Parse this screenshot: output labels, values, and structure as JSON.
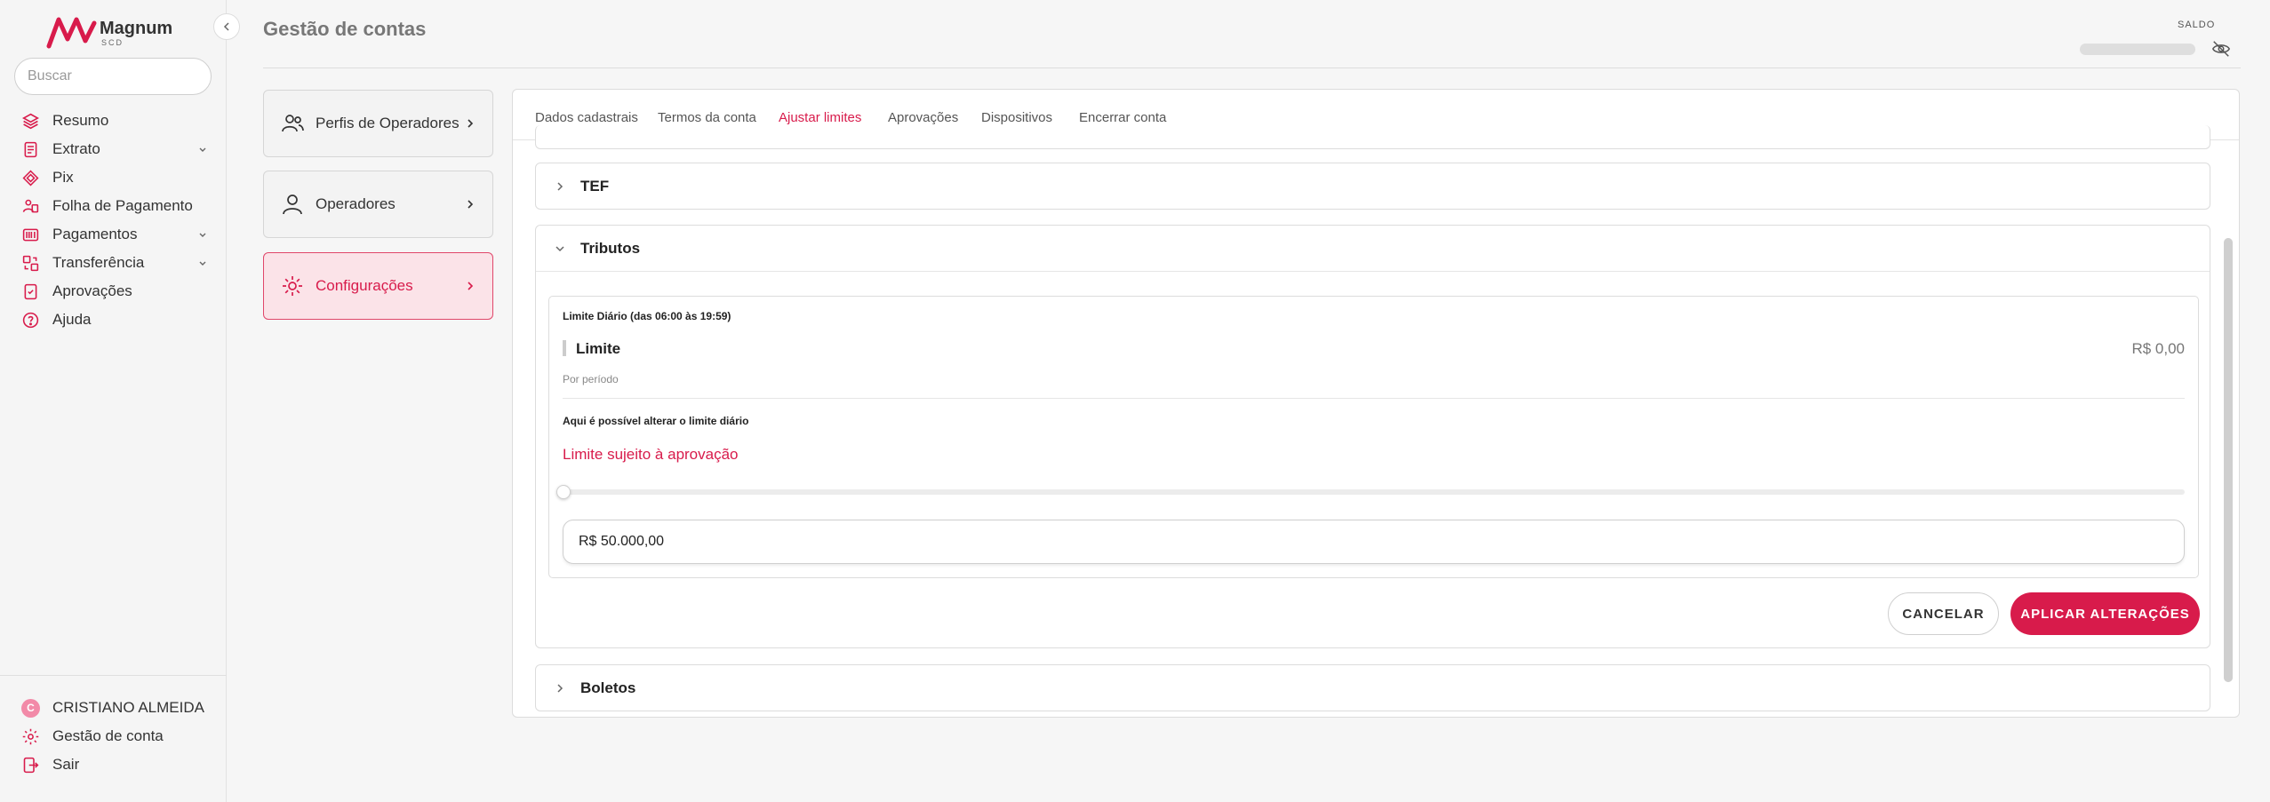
{
  "app": {
    "brand": "Magnum",
    "brand_sub": "SCD",
    "page_title": "Gestão de contas",
    "saldo_label": "SALDO",
    "accent_color": "#d81b4b"
  },
  "sidebar": {
    "search_placeholder": "Buscar",
    "items": [
      {
        "label": "Resumo",
        "icon": "layers-icon"
      },
      {
        "label": "Extrato",
        "icon": "document-icon",
        "expandable": true
      },
      {
        "label": "Pix",
        "icon": "pix-icon"
      },
      {
        "label": "Folha de Pagamento",
        "icon": "payroll-icon"
      },
      {
        "label": "Pagamentos",
        "icon": "barcode-icon",
        "expandable": true
      },
      {
        "label": "Transferência",
        "icon": "transfer-icon",
        "expandable": true
      },
      {
        "label": "Aprovações",
        "icon": "approval-icon"
      },
      {
        "label": "Ajuda",
        "icon": "help-icon"
      }
    ],
    "footer": {
      "user_initial": "C",
      "user_name": "CRISTIANO ALMEIDA",
      "account_label": "Gestão de conta",
      "logout_label": "Sair"
    }
  },
  "menu": {
    "items": [
      {
        "label": "Perfis de Operadores",
        "icon": "users-icon"
      },
      {
        "label": "Operadores",
        "icon": "user-icon"
      },
      {
        "label": "Configurações",
        "icon": "gear-icon",
        "active": true
      }
    ]
  },
  "tabs": [
    {
      "label": "Dados cadastrais"
    },
    {
      "label": "Termos da conta"
    },
    {
      "label": "Ajustar limites",
      "active": true
    },
    {
      "label": "Aprovações"
    },
    {
      "label": "Dispositivos"
    },
    {
      "label": "Encerrar conta"
    }
  ],
  "sections": {
    "tef": "TEF",
    "tributos": "Tributos",
    "boletos": "Boletos"
  },
  "limit": {
    "header": "Limite Diário (das 06:00 às 19:59)",
    "label": "Limite",
    "value": "R$ 0,00",
    "period": "Por período",
    "info": "Aqui é possível alterar o limite diário",
    "approval_notice": "Limite sujeito à aprovação",
    "slider_level": 0,
    "input_value": "R$ 50.000,00"
  },
  "actions": {
    "cancel": "CANCELAR",
    "apply": "APLICAR ALTERAÇÕES"
  }
}
